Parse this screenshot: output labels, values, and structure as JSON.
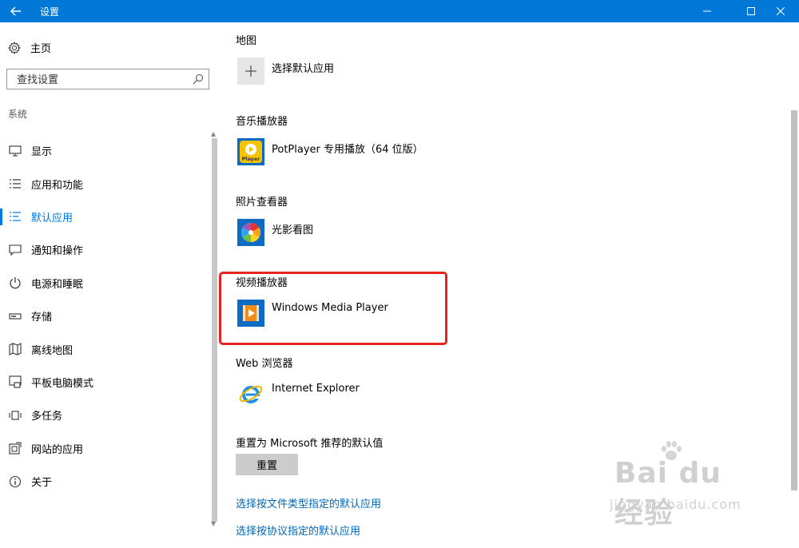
{
  "window": {
    "title": "设置",
    "back_icon": "back-arrow-icon"
  },
  "sidebar": {
    "home_label": "主页",
    "search_placeholder": "查找设置",
    "section_label": "系统",
    "items": [
      {
        "label": "显示",
        "icon": "display-icon",
        "active": false
      },
      {
        "label": "应用和功能",
        "icon": "apps-list-icon",
        "active": false
      },
      {
        "label": "默认应用",
        "icon": "default-apps-icon",
        "active": true
      },
      {
        "label": "通知和操作",
        "icon": "notification-icon",
        "active": false
      },
      {
        "label": "电源和睡眠",
        "icon": "power-icon",
        "active": false
      },
      {
        "label": "存储",
        "icon": "storage-icon",
        "active": false
      },
      {
        "label": "离线地图",
        "icon": "map-icon",
        "active": false
      },
      {
        "label": "平板电脑模式",
        "icon": "tablet-icon",
        "active": false
      },
      {
        "label": "多任务",
        "icon": "multitask-icon",
        "active": false
      },
      {
        "label": "网站的应用",
        "icon": "web-apps-icon",
        "active": false
      },
      {
        "label": "关于",
        "icon": "info-icon",
        "active": false
      }
    ]
  },
  "main": {
    "maps": {
      "category": "地图",
      "app": "选择默认应用"
    },
    "music": {
      "category": "音乐播放器",
      "app": "PotPlayer 专用播放（64 位版）",
      "icon_text": "Player"
    },
    "photo": {
      "category": "照片查看器",
      "app": "光影看图"
    },
    "video": {
      "category": "视频播放器",
      "app": "Windows Media Player"
    },
    "web": {
      "category": "Web 浏览器",
      "app": "Internet Explorer"
    },
    "reset_label": "重置为 Microsoft 推荐的默认值",
    "reset_button": "重置",
    "link1": "选择按文件类型指定的默认应用",
    "link2": "选择按协议指定的默认应用"
  },
  "watermark": {
    "logo": "Bai du 经验",
    "url": "jingyan.baidu.com"
  },
  "colors": {
    "accent": "#0078d7",
    "highlight_box": "#e6241d",
    "link": "#0067b8"
  }
}
